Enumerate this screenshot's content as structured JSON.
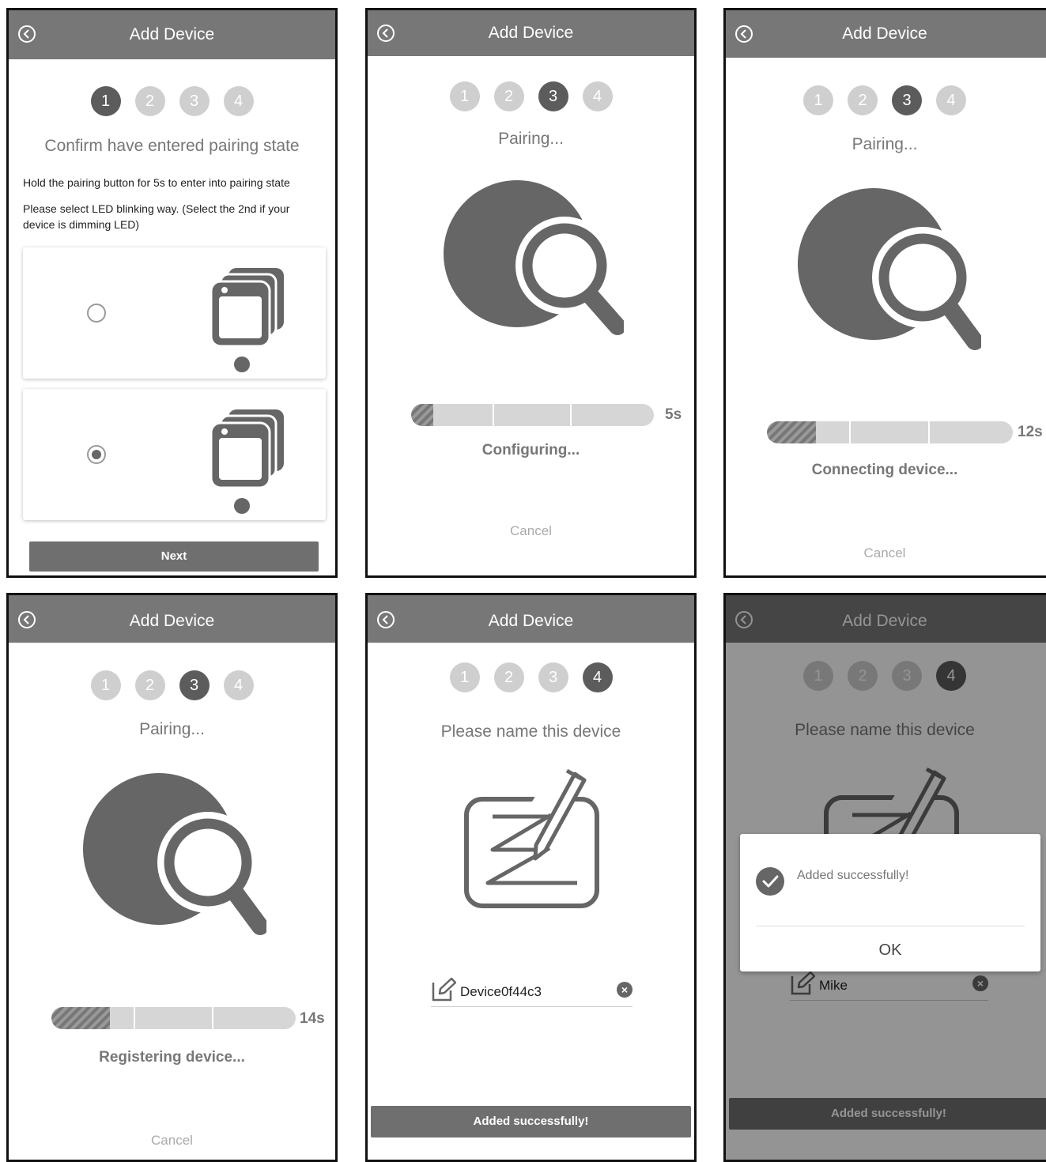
{
  "header": {
    "title": "Add Device"
  },
  "steps": [
    "1",
    "2",
    "3",
    "4"
  ],
  "panel1": {
    "heading": "Confirm have entered pairing state",
    "instruction1": "Hold the pairing button for 5s to enter into pairing state",
    "instruction2": "Please select LED blinking way. (Select the 2nd if your device is dimming LED)",
    "option1_selected": false,
    "option2_selected": true,
    "next_label": "Next"
  },
  "pairing_label": "Pairing...",
  "cancel_label": "Cancel",
  "panel2": {
    "time": "5s",
    "status": "Configuring...",
    "progress": 0.09
  },
  "panel3": {
    "time": "12s",
    "status": "Connecting device...",
    "progress": 0.2
  },
  "panel4": {
    "time": "14s",
    "status": "Registering device...",
    "progress": 0.24
  },
  "panel5": {
    "heading": "Please name this device",
    "device_name": "Device0f44c3",
    "button_label": "Added successfully!"
  },
  "panel6": {
    "heading": "Please name this device",
    "device_name": "Mike",
    "dialog_message": "Added successfully!",
    "ok_label": "OK",
    "button_label": "Added successfully!"
  },
  "colors": {
    "header": "#777777",
    "active_step": "#5c5c5c",
    "inactive_step": "#cfcfcf"
  }
}
